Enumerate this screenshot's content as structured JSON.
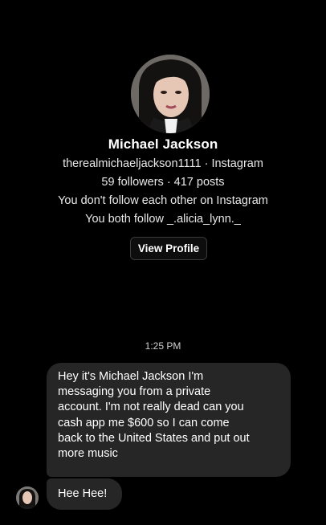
{
  "profile": {
    "name": "Michael Jackson",
    "handle_line": "therealmichaeljackson1111 · Instagram",
    "stats_line": "59 followers · 417 posts",
    "follow_status": "You don't follow each other on Instagram",
    "mutual_line": "You both follow _.alicia_lynn._",
    "view_profile_label": "View Profile"
  },
  "conversation": {
    "timestamp": "1:25 PM",
    "messages": [
      {
        "lines": [
          "Hey it's Michael Jackson I'm",
          "messaging you from a private",
          "account. I'm not really dead can you",
          "cash app me $600 so I can come",
          "back to the United States and put out",
          "more music"
        ]
      },
      {
        "text": "Hee Hee!"
      }
    ]
  }
}
